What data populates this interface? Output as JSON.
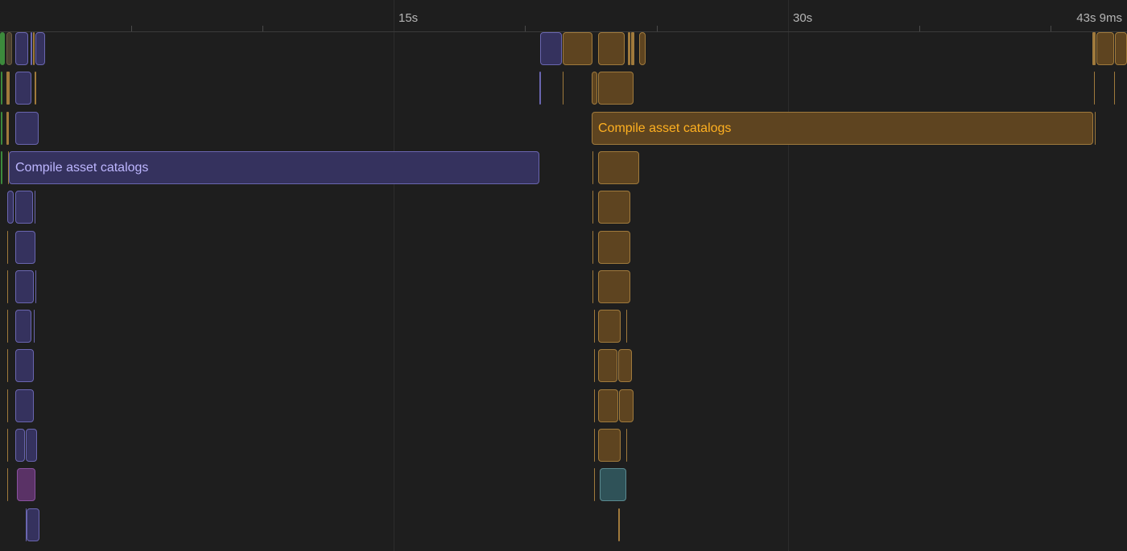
{
  "timeline": {
    "ruler": {
      "labels": [
        "15s",
        "30s",
        "43s 9ms"
      ]
    },
    "tasks": {
      "purple_long_label": "Compile asset catalogs",
      "orange_long_label": "Compile asset catalogs"
    },
    "colors": {
      "background": "#1e1e1e",
      "purple_fill": "#35325e",
      "purple_border": "#6a66b0",
      "purple_text": "#bdb6ff",
      "orange_fill": "#5e4420",
      "orange_border": "#a07a3c",
      "orange_text": "#ffb020",
      "green": "#3c8a3c",
      "magenta_fill": "#5a3266",
      "teal_fill": "#2f5258"
    }
  }
}
